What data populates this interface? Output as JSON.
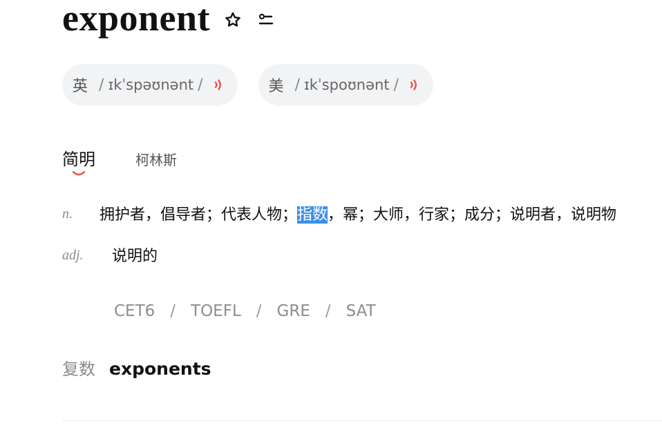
{
  "word": {
    "headword": "exponent"
  },
  "icons": {
    "favorite": "star-icon",
    "list": "word-list-icon",
    "speaker": "speaker-icon"
  },
  "pronunciations": [
    {
      "region": "英",
      "ipa": "ɪkˈspəʊnənt",
      "slash": "/"
    },
    {
      "region": "美",
      "ipa": "ɪkˈspoʊnənt",
      "slash": "/"
    }
  ],
  "tabs": [
    {
      "label": "简明",
      "active": true
    },
    {
      "label": "柯林斯",
      "active": false
    }
  ],
  "definitions": [
    {
      "pos": "n.",
      "before": "拥护者，倡导者；代表人物；",
      "highlight": "指数",
      "after": "，幂；大师，行家；成分；说明者，说明物"
    },
    {
      "pos": "adj.",
      "text": "说明的"
    }
  ],
  "exam_tags": [
    "CET6",
    "TOEFL",
    "GRE",
    "SAT"
  ],
  "tag_separator": "/",
  "plural": {
    "label": "复数",
    "value": "exponents"
  },
  "colors": {
    "accent": "#e8534a",
    "highlight": "#3a8ee6",
    "pill_bg": "#f2f3f5"
  }
}
